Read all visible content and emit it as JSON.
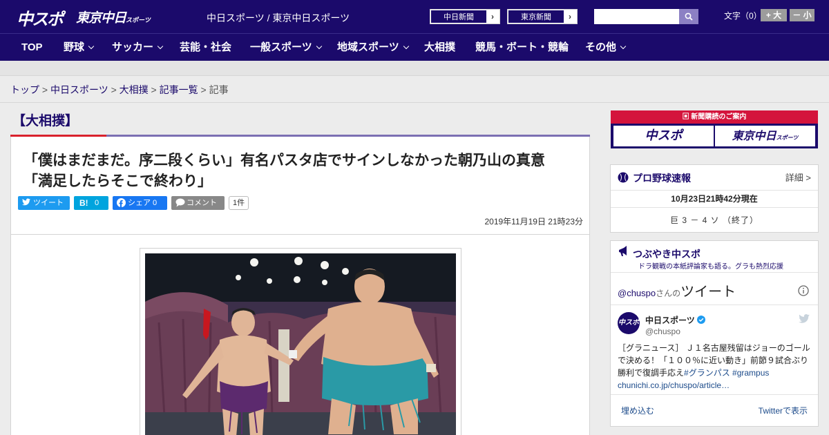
{
  "header": {
    "logo_chuspo": "中スポ",
    "logo_tokyo": "東京中日",
    "logo_tokyo_small": "スポーツ",
    "site_name": "中日スポーツ / 東京中日スポーツ",
    "paper_links": [
      {
        "label": "中日新聞"
      },
      {
        "label": "東京新聞"
      }
    ],
    "search_placeholder": "",
    "font_size_label": "文字（0）",
    "font_bigger": "+ 大",
    "font_smaller": "－ 小"
  },
  "nav": {
    "items": [
      {
        "label": "TOP",
        "has_menu": false
      },
      {
        "label": "野球",
        "has_menu": true
      },
      {
        "label": "サッカー",
        "has_menu": true
      },
      {
        "label": "芸能・社会",
        "has_menu": false
      },
      {
        "label": "一般スポーツ",
        "has_menu": true
      },
      {
        "label": "地域スポーツ",
        "has_menu": true
      },
      {
        "label": "大相撲",
        "has_menu": false
      },
      {
        "label": "競馬・ボート・競輪",
        "has_menu": false
      },
      {
        "label": "その他",
        "has_menu": true
      }
    ]
  },
  "breadcrumb": {
    "items": [
      "トップ",
      "中日スポーツ",
      "大相撲",
      "記事一覧"
    ],
    "current": "記事",
    "sep": " > "
  },
  "article": {
    "category": "【大相撲】",
    "headline_line1": "「僕はまだまだ。序二段くらい」有名パスタ店でサインしなかった朝乃山の真意",
    "headline_line2": "「満足したらそこで終わり」",
    "share": {
      "tweet": "ツイート",
      "hatena_count": "0",
      "facebook": "シェア 0",
      "comment": "コメント",
      "comment_count": "1件"
    },
    "date": "2019年11月19日 21時23分"
  },
  "sidebar": {
    "subscribe_title": "新聞購読のご案内",
    "subscribe_chuspo": "中スポ",
    "subscribe_tokyo": "東京中日",
    "subscribe_tokyo_small": "スポーツ",
    "baseball": {
      "title": "プロ野球速報",
      "detail": "詳細 >",
      "time": "10月23日21時42分現在",
      "score": "巨 3 － 4 ソ （終了）"
    },
    "twitter": {
      "title": "つぶやき中スポ",
      "subtitle": "ドラ観戦の本紙評論家も語る。グラも熱烈応援",
      "handle_prefix": "@chuspo",
      "handle_mid": "さんの",
      "handle_big": "ツイート",
      "account_name": "中日スポーツ",
      "account_user": "@chuspo",
      "tweet_line1": "［グラニュース］ Ｊ１名古屋残留はジョーのゴール",
      "tweet_line2": "で決める！「１００％に近い動き」前節９試合ぶり",
      "tweet_line3_text": "勝利で復調手応え",
      "tweet_line3_tags": "#グランパス #grampus",
      "tweet_line4": "chunichi.co.jp/chuspo/article…",
      "embed": "埋め込む",
      "view_on_twitter": "Twitterで表示",
      "avatar_text": "中スポ"
    }
  }
}
